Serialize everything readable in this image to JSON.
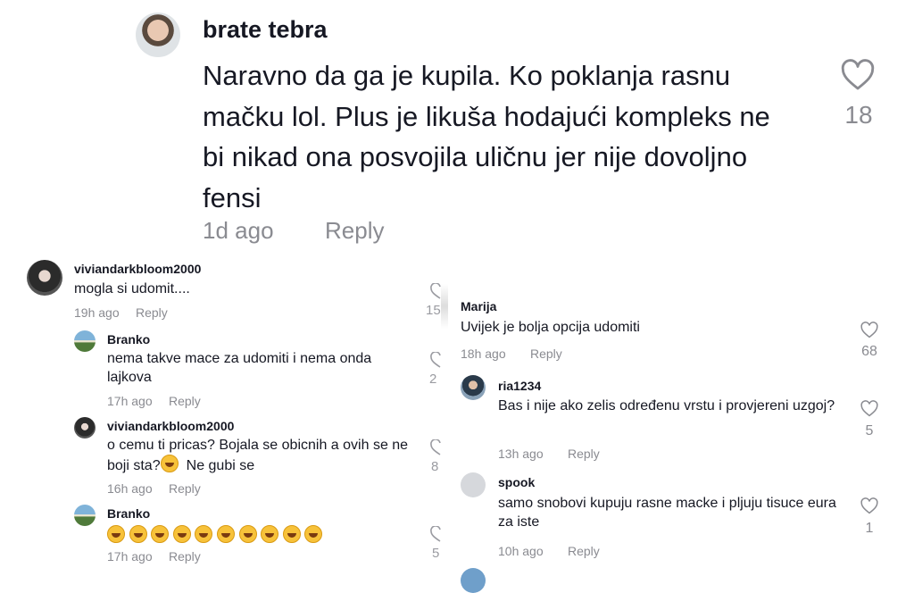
{
  "top_comment": {
    "username": "brate tebra",
    "text": "Naravno da ga je kupila. Ko poklanja rasnu mačku lol. Plus je likuša hodajući kompleks ne bi nikad ona posvojila uličnu jer nije dovoljno fensi",
    "time": "1d ago",
    "reply_label": "Reply",
    "likes": "18"
  },
  "left_thread": [
    {
      "username": "viviandarkbloom2000",
      "text": "mogla si udomit....",
      "time": "19h ago",
      "reply_label": "Reply",
      "likes_partial": "15"
    },
    {
      "username": "Branko",
      "text": "nema takve mace za udomiti i nema onda lajkova",
      "time": "17h ago",
      "reply_label": "Reply",
      "likes_partial": "2"
    },
    {
      "username": "viviandarkbloom2000",
      "text": "o cemu ti pricas? Bojala se obicnih a ovih se ne boji sta?",
      "text_after_emoji": " Ne gubi se",
      "time": "16h ago",
      "reply_label": "Reply",
      "likes_partial": "8"
    },
    {
      "username": "Branko",
      "emoji_count": 10,
      "emoji_name": "rolling-on-floor-laughing-emoji",
      "time": "17h ago",
      "reply_label": "Reply",
      "likes_partial": "5"
    }
  ],
  "right_thread": [
    {
      "username": "Marija",
      "text": "Uvijek je bolja opcija udomiti",
      "time": "18h ago",
      "reply_label": "Reply",
      "likes": "68"
    },
    {
      "username": "ria1234",
      "text": "Bas i nije ako zelis određenu vrstu i provjereni uzgoj?",
      "time": "13h ago",
      "reply_label": "Reply",
      "likes": "5"
    },
    {
      "username": "spook",
      "text": "samo snobovi kupuju rasne macke i pljuju tisuce eura za iste",
      "time": "10h ago",
      "reply_label": "Reply",
      "likes": "1"
    }
  ],
  "icons": {
    "like": "heart-outline-icon",
    "avatar_placeholder": "default-avatar-icon"
  },
  "colors": {
    "text": "#161823",
    "muted": "#8a8b91",
    "background": "#ffffff"
  }
}
